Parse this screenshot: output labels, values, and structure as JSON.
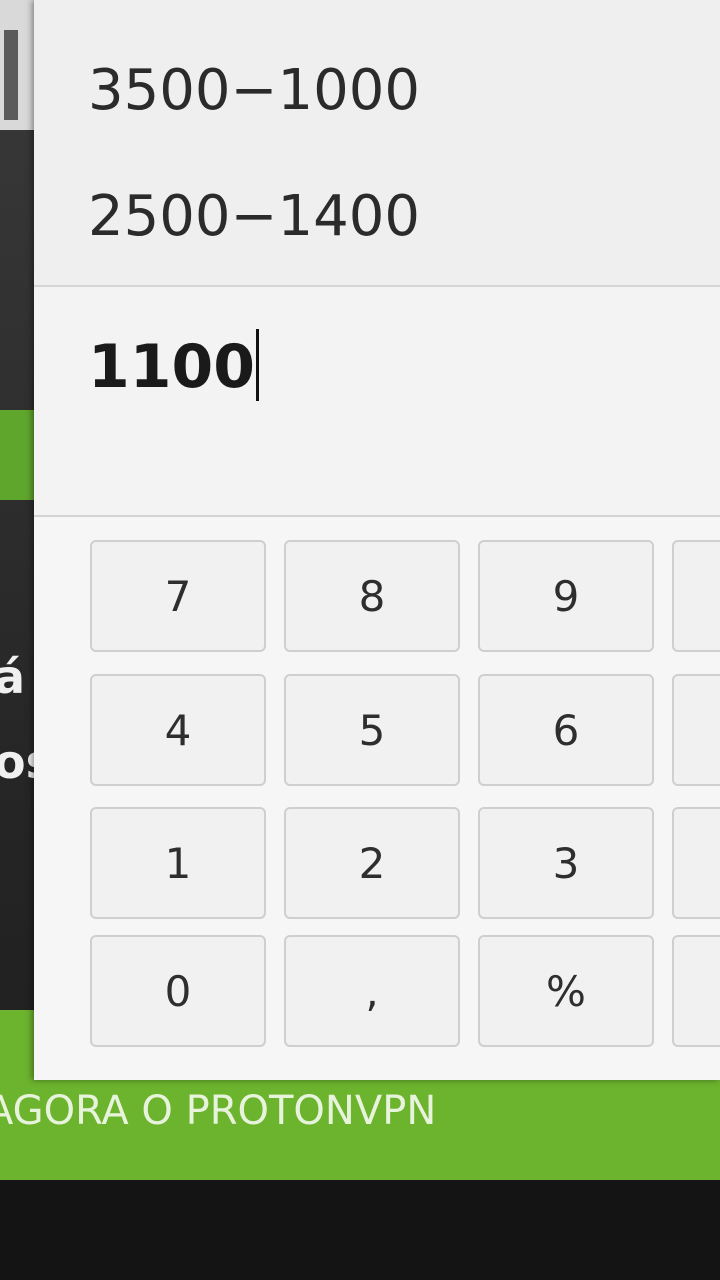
{
  "background": {
    "text_line_1": "á",
    "text_line_2": "os",
    "banner_text": "AGORA O PROTONVPN"
  },
  "calculator": {
    "history": [
      "3500−1000",
      "2500−1400"
    ],
    "current_entry": "1100",
    "keys": [
      [
        "7",
        "8",
        "9",
        ""
      ],
      [
        "4",
        "5",
        "6",
        ""
      ],
      [
        "1",
        "2",
        "3",
        ""
      ],
      [
        "0",
        ",",
        "%",
        ""
      ]
    ]
  },
  "colors": {
    "banner_green": "#6cb32e",
    "calculator_background": "#f4f4f4",
    "key_border": "#cfcfcf"
  }
}
